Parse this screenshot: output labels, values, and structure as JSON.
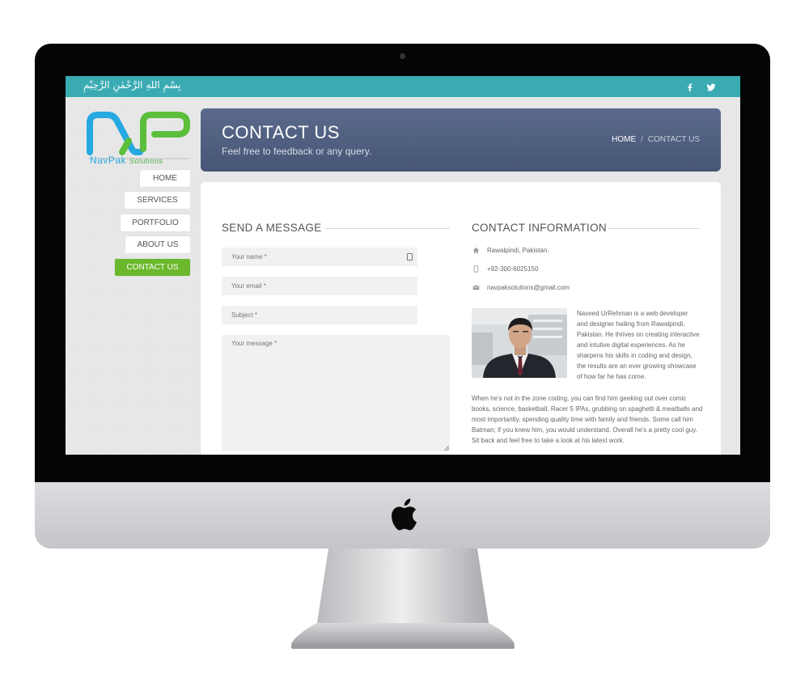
{
  "topbar": {
    "bismillah": "بِسْمِ اللهِ الرَّحْمٰنِ الرَّحِيْمِ",
    "social_icons": [
      "facebook-icon",
      "twitter-icon"
    ]
  },
  "logo": {
    "letters": "NP",
    "name_nav": "NavPak",
    "name_solutions": "Solutions",
    "colors": {
      "blue": "#26a9e0",
      "green": "#4caf50"
    }
  },
  "nav": {
    "items": [
      {
        "label": "HOME"
      },
      {
        "label": "SERVICES"
      },
      {
        "label": "PORTFOLIO"
      },
      {
        "label": "ABOUT US"
      },
      {
        "label": "CONTACT US",
        "active": true
      }
    ]
  },
  "header": {
    "title": "CONTACT US",
    "subtitle": "Feel free to feedback or any query.",
    "breadcrumb": {
      "home": "HOME",
      "separator": "/",
      "current": "CONTACT US"
    }
  },
  "form": {
    "title": "SEND A MESSAGE",
    "name_placeholder": "Your name *",
    "email_placeholder": "Your email *",
    "subject_placeholder": "Subject *",
    "message_placeholder": "Your message *"
  },
  "contact": {
    "title": "CONTACT INFORMATION",
    "address": "Rawalpindi, Pakistan.",
    "phone": "+92-300-6025150",
    "email": "navpaksolutions@gmail.com",
    "bio_short": "Naveed UrRehman is a web developer and designer hailing from Rawalpindi, Pakistan. He thrives on creating interactive and intutive digital experiences. As he sharpens his skills in coding and design, the results are an ever growing showcase of how far he has come.",
    "bio_long": "When he's not in the zone coding, you can find him geeking out over comic books, science, basketball, Racer 5 IPAs, grubbing on spaghetti & meatballs and most importantly, spending quality time with family and friends. Some call him Batman; if you knew him, you would understand. Overall he's a pretty cool guy. Sit back and feel free to take a look at his latest work."
  },
  "colors": {
    "topbar": "#3aabb3",
    "header": "#516080",
    "active_nav": "#6bb82c"
  }
}
